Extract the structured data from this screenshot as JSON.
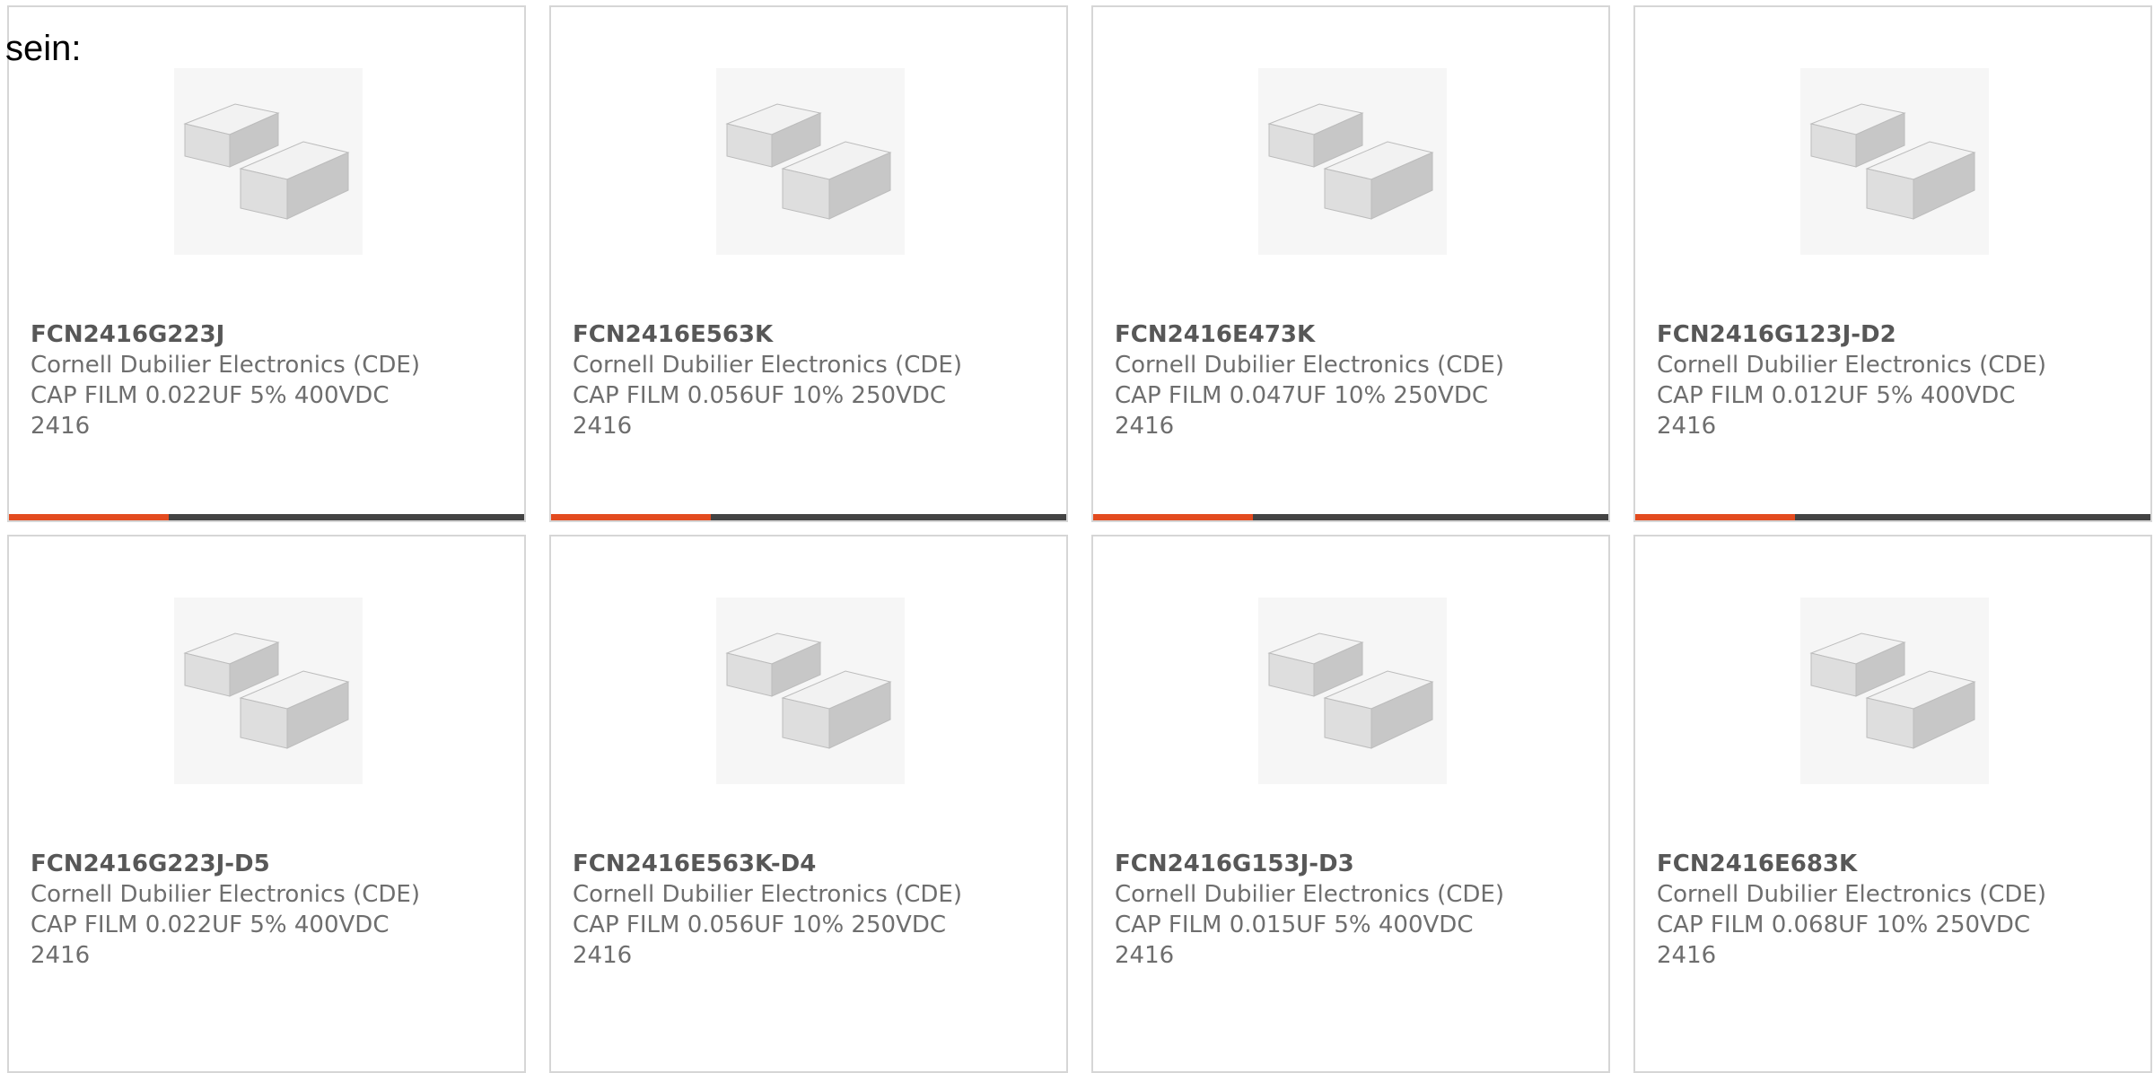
{
  "intro_text": "sein:",
  "colors": {
    "card_border": "#d6d6d6",
    "accent": "#e34b1f",
    "bar_track": "#434343",
    "part_number": "#575757",
    "body_text": "#6e6e6e"
  },
  "products": [
    {
      "part_number": "FCN2416G223J",
      "manufacturer": "Cornell Dubilier Electronics (CDE)",
      "description": "CAP FILM 0.022UF 5% 400VDC",
      "package": "2416",
      "image_icon": "film-capacitor-pair-icon",
      "bar_progress": 0.31
    },
    {
      "part_number": "FCN2416E563K",
      "manufacturer": "Cornell Dubilier Electronics (CDE)",
      "description": "CAP FILM 0.056UF 10% 250VDC",
      "package": "2416",
      "image_icon": "film-capacitor-pair-icon",
      "bar_progress": 0.31
    },
    {
      "part_number": "FCN2416E473K",
      "manufacturer": "Cornell Dubilier Electronics (CDE)",
      "description": "CAP FILM 0.047UF 10% 250VDC",
      "package": "2416",
      "image_icon": "film-capacitor-pair-icon",
      "bar_progress": 0.31
    },
    {
      "part_number": "FCN2416G123J-D2",
      "manufacturer": "Cornell Dubilier Electronics (CDE)",
      "description": "CAP FILM 0.012UF 5% 400VDC",
      "package": "2416",
      "image_icon": "film-capacitor-pair-icon",
      "bar_progress": 0.31
    },
    {
      "part_number": "FCN2416G223J-D5",
      "manufacturer": "Cornell Dubilier Electronics (CDE)",
      "description": "CAP FILM 0.022UF 5% 400VDC",
      "package": "2416",
      "image_icon": "film-capacitor-pair-icon"
    },
    {
      "part_number": "FCN2416E563K-D4",
      "manufacturer": "Cornell Dubilier Electronics (CDE)",
      "description": "CAP FILM 0.056UF 10% 250VDC",
      "package": "2416",
      "image_icon": "film-capacitor-pair-icon"
    },
    {
      "part_number": "FCN2416G153J-D3",
      "manufacturer": "Cornell Dubilier Electronics (CDE)",
      "description": "CAP FILM 0.015UF 5% 400VDC",
      "package": "2416",
      "image_icon": "film-capacitor-pair-icon"
    },
    {
      "part_number": "FCN2416E683K",
      "manufacturer": "Cornell Dubilier Electronics (CDE)",
      "description": "CAP FILM 0.068UF 10% 250VDC",
      "package": "2416",
      "image_icon": "film-capacitor-pair-icon"
    }
  ]
}
